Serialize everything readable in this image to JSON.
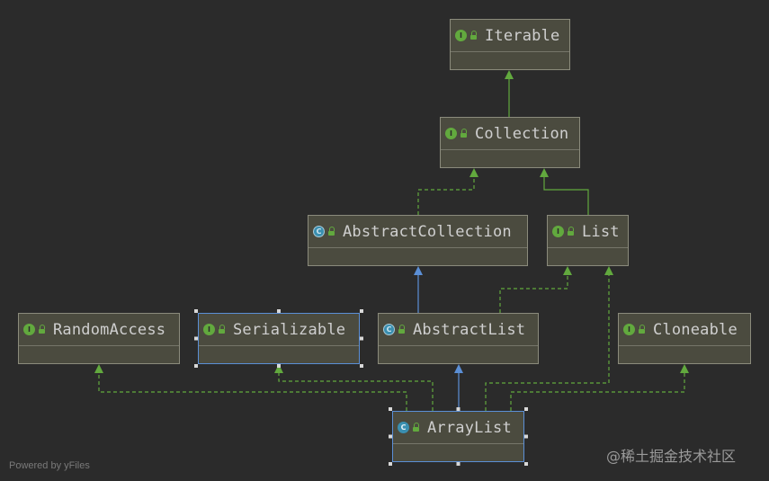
{
  "diagram": {
    "nodes": [
      {
        "id": "iterable",
        "label": "Iterable",
        "kind": "interface",
        "kind_letter": "I"
      },
      {
        "id": "collection",
        "label": "Collection",
        "kind": "interface",
        "kind_letter": "I"
      },
      {
        "id": "abstractcollection",
        "label": "AbstractCollection",
        "kind": "abstract",
        "kind_letter": "C"
      },
      {
        "id": "list",
        "label": "List",
        "kind": "interface",
        "kind_letter": "I"
      },
      {
        "id": "randomaccess",
        "label": "RandomAccess",
        "kind": "interface",
        "kind_letter": "I"
      },
      {
        "id": "serializable",
        "label": "Serializable",
        "kind": "interface",
        "kind_letter": "I"
      },
      {
        "id": "abstractlist",
        "label": "AbstractList",
        "kind": "abstract",
        "kind_letter": "C"
      },
      {
        "id": "cloneable",
        "label": "Cloneable",
        "kind": "interface",
        "kind_letter": "I"
      },
      {
        "id": "arraylist",
        "label": "ArrayList",
        "kind": "class",
        "kind_letter": "C"
      }
    ],
    "edges": [
      {
        "from": "collection",
        "to": "iterable",
        "relation": "extends"
      },
      {
        "from": "abstractcollection",
        "to": "collection",
        "relation": "implements"
      },
      {
        "from": "list",
        "to": "collection",
        "relation": "extends"
      },
      {
        "from": "abstractlist",
        "to": "abstractcollection",
        "relation": "class-extends"
      },
      {
        "from": "abstractlist",
        "to": "list",
        "relation": "implements"
      },
      {
        "from": "arraylist",
        "to": "randomaccess",
        "relation": "implements"
      },
      {
        "from": "arraylist",
        "to": "serializable",
        "relation": "implements"
      },
      {
        "from": "arraylist",
        "to": "abstractlist",
        "relation": "class-extends"
      },
      {
        "from": "arraylist",
        "to": "list",
        "relation": "implements"
      },
      {
        "from": "arraylist",
        "to": "cloneable",
        "relation": "implements"
      }
    ],
    "selected": [
      "serializable",
      "arraylist"
    ]
  },
  "colors": {
    "background": "#2b2b2b",
    "node_fill": "#4b4b3f",
    "node_border": "#8b8b7c",
    "selected_border": "#5b8fd6",
    "interface_edge": "#62a93e",
    "class_edge": "#5b8fd6",
    "interface_icon": "#62a93e",
    "class_icon": "#3a8fb0"
  },
  "footer": {
    "powered_by": "Powered by yFiles",
    "watermark": "@稀土掘金技术社区"
  }
}
